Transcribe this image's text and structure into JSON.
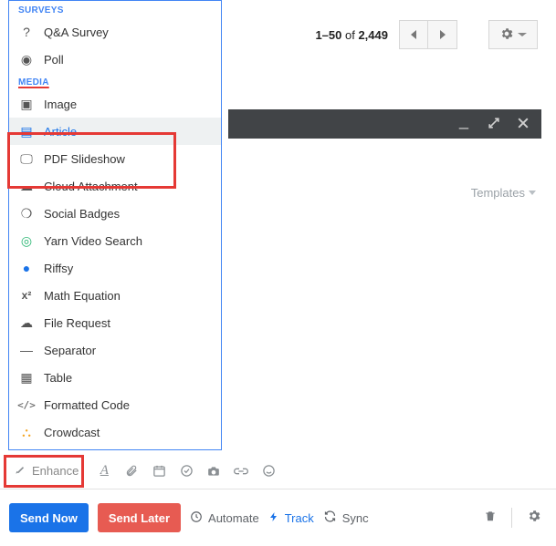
{
  "pager": {
    "range": "1–50",
    "of_word": "of",
    "total": "2,449"
  },
  "darkbar": {
    "min": "_",
    "exp": "⤢",
    "close": "✕"
  },
  "templates": {
    "label": "Templates"
  },
  "panel": {
    "section_surveys": "SURVEYS",
    "section_media": "MEDIA",
    "surveys": [
      {
        "label": "Q&A Survey",
        "icon": "?"
      },
      {
        "label": "Poll",
        "icon": "◉"
      }
    ],
    "media": [
      {
        "label": "Image",
        "icon": "▣"
      },
      {
        "label": "Article",
        "icon": "▤",
        "selected": true
      },
      {
        "label": "PDF Slideshow",
        "icon": "🖵"
      },
      {
        "label": "Cloud Attachment",
        "icon": "☁"
      },
      {
        "label": "Social Badges",
        "icon": "❍"
      },
      {
        "label": "Yarn Video Search",
        "icon": "◎"
      },
      {
        "label": "Riffsy",
        "icon": "●"
      },
      {
        "label": "Math Equation",
        "icon": "x²"
      },
      {
        "label": "File Request",
        "icon": "☁"
      },
      {
        "label": "Separator",
        "icon": "—"
      },
      {
        "label": "Table",
        "icon": "▦"
      },
      {
        "label": "Formatted Code",
        "icon": "</>"
      },
      {
        "label": "Crowdcast",
        "icon": "⛬"
      }
    ]
  },
  "enhance": {
    "label": "Enhance"
  },
  "bottom": {
    "send_now": "Send Now",
    "send_later": "Send Later",
    "automate": "Automate",
    "track": "Track",
    "sync": "Sync"
  }
}
